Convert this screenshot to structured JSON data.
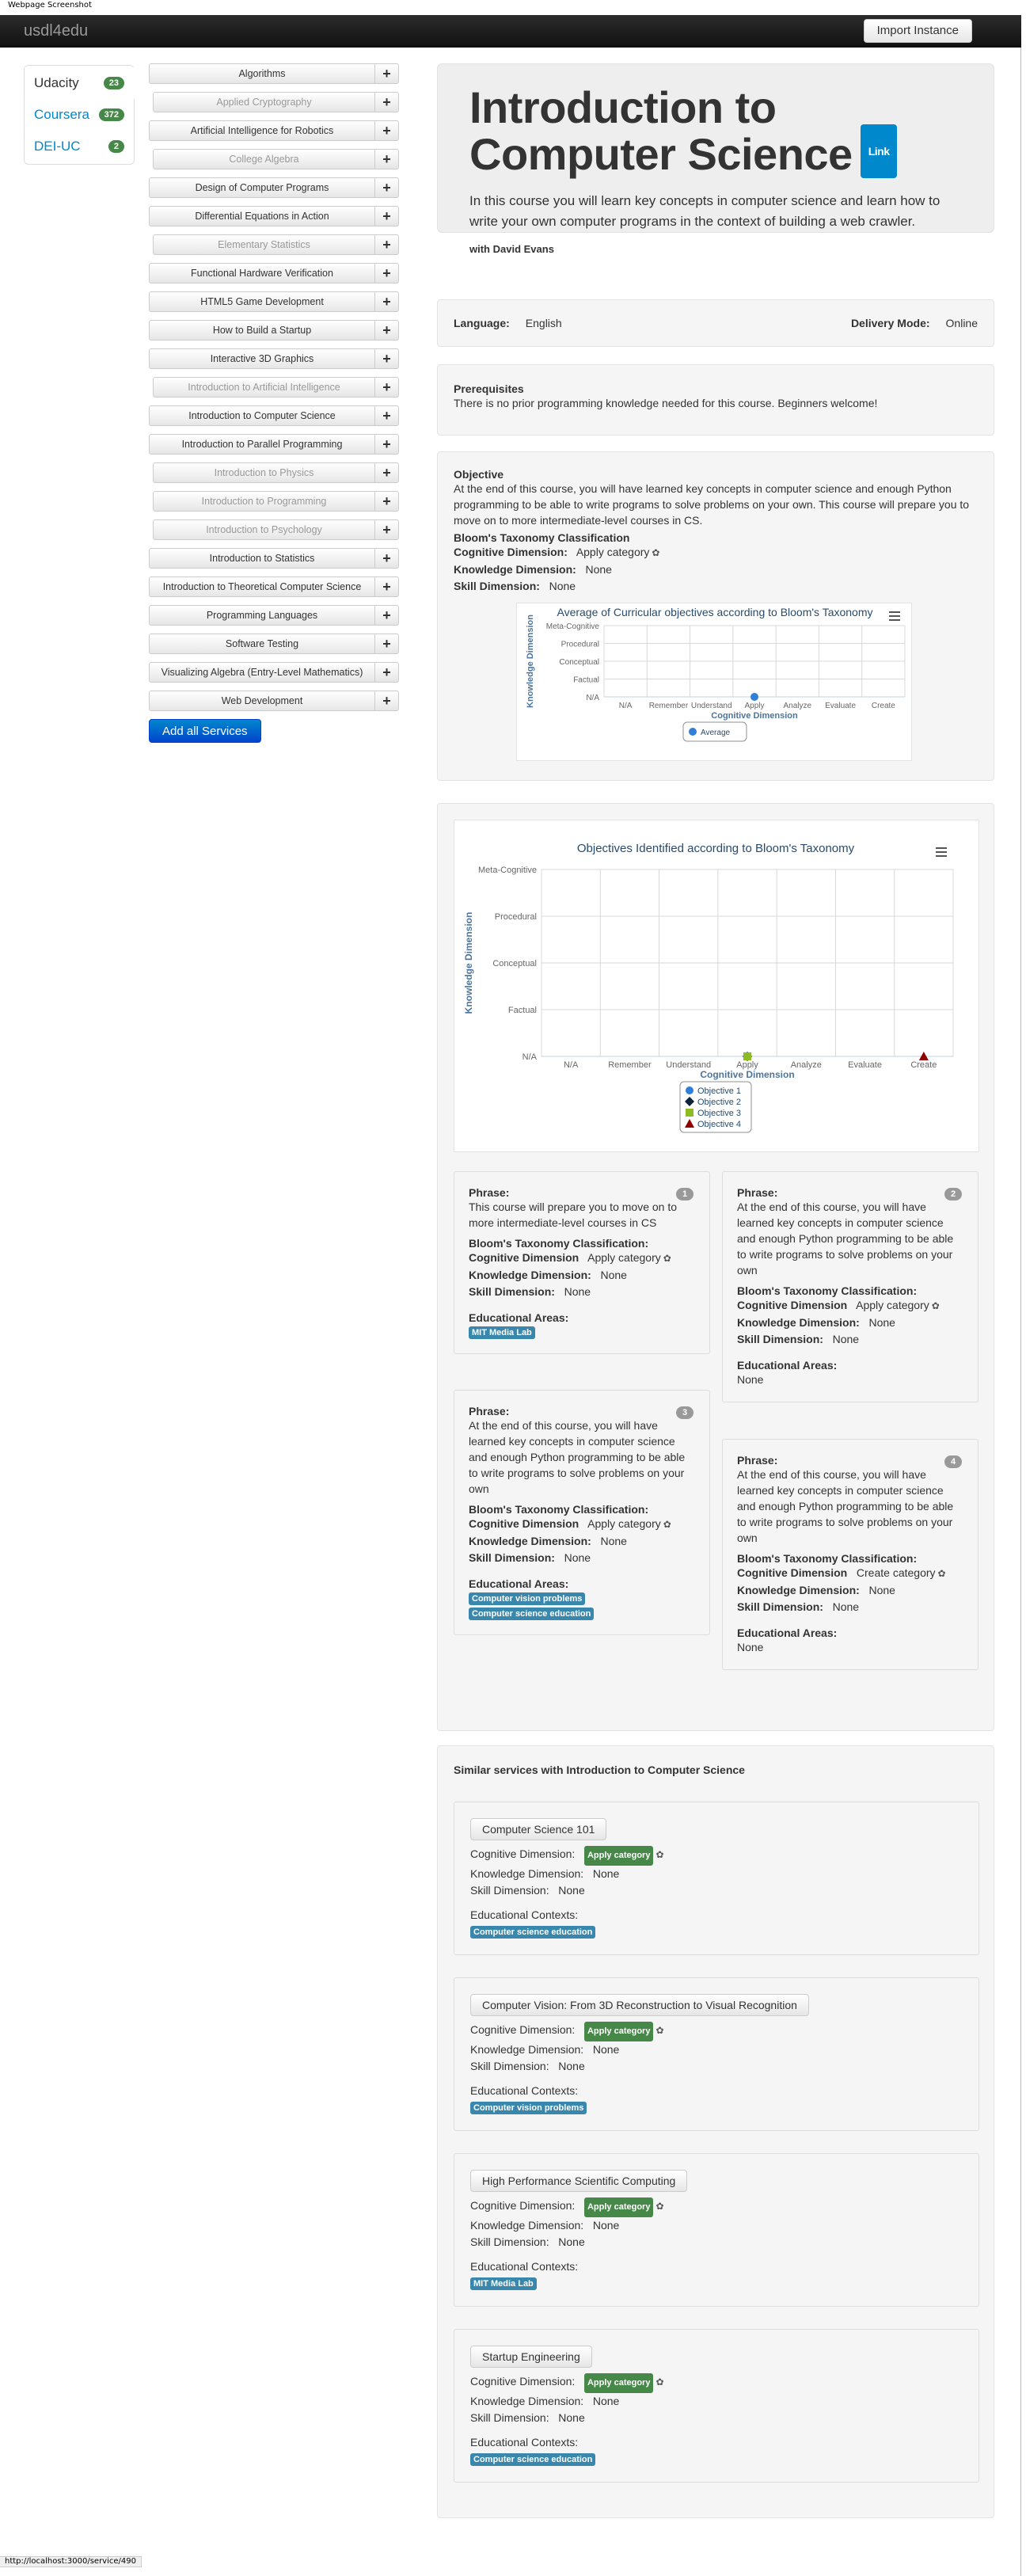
{
  "window_title": "Webpage Screenshot",
  "navbar": {
    "brand": "usdl4edu",
    "import_label": "Import Instance"
  },
  "providers": [
    {
      "name": "Udacity",
      "count": "23",
      "active": true
    },
    {
      "name": "Coursera",
      "count": "372",
      "active": false
    },
    {
      "name": "DEI-UC",
      "count": "2",
      "active": false
    }
  ],
  "services": [
    {
      "name": "Algorithms",
      "muted": false
    },
    {
      "name": "Applied Cryptography",
      "muted": true
    },
    {
      "name": "Artificial Intelligence for Robotics",
      "muted": false
    },
    {
      "name": "College Algebra",
      "muted": true
    },
    {
      "name": "Design of Computer Programs",
      "muted": false
    },
    {
      "name": "Differential Equations in Action",
      "muted": false
    },
    {
      "name": "Elementary Statistics",
      "muted": true
    },
    {
      "name": "Functional Hardware Verification",
      "muted": false
    },
    {
      "name": "HTML5 Game Development",
      "muted": false
    },
    {
      "name": "How to Build a Startup",
      "muted": false
    },
    {
      "name": "Interactive 3D Graphics",
      "muted": false
    },
    {
      "name": "Introduction to Artificial Intelligence",
      "muted": true
    },
    {
      "name": "Introduction to Computer Science",
      "muted": false
    },
    {
      "name": "Introduction to Parallel Programming",
      "muted": false
    },
    {
      "name": "Introduction to Physics",
      "muted": true
    },
    {
      "name": "Introduction to Programming",
      "muted": true
    },
    {
      "name": "Introduction to Psychology",
      "muted": true
    },
    {
      "name": "Introduction to Statistics",
      "muted": false
    },
    {
      "name": "Introduction to Theoretical Computer Science",
      "muted": false
    },
    {
      "name": "Programming Languages",
      "muted": false
    },
    {
      "name": "Software Testing",
      "muted": false
    },
    {
      "name": "Visualizing Algebra (Entry-Level Mathematics)",
      "muted": false
    },
    {
      "name": "Web Development",
      "muted": false
    }
  ],
  "add_all_label": "Add all Services",
  "course": {
    "title": "Introduction to Computer Science",
    "link_label": "Link",
    "description": "In this course you will learn key concepts in computer science and learn how to write your own computer programs in the context of building a web crawler.",
    "instructor": "with David Evans",
    "language_label": "Language:",
    "language": "English",
    "delivery_label": "Delivery Mode:",
    "delivery": "Online",
    "prereq_title": "Prerequisites",
    "prereq_text": "There is no prior programming knowledge needed for this course. Beginners welcome!",
    "objective_title": "Objective",
    "objective_text": "At the end of this course, you will have learned key concepts in computer science and enough Python programming to be able to write programs to solve problems on your own. This course will prepare you to move on to more intermediate-level courses in CS.",
    "taxonomy_title": "Bloom's Taxonomy Classification",
    "cog_label": "Cognitive Dimension:",
    "cog_value": "Apply category",
    "know_label": "Knowledge Dimension:",
    "know_value": "None",
    "skill_label": "Skill Dimension:",
    "skill_value": "None"
  },
  "chart_data": [
    {
      "type": "scatter",
      "title": "Average of Curricular objectives according to Bloom's Taxonomy",
      "xlabel": "Cognitive Dimension",
      "ylabel": "Knowledge Dimension",
      "x_categories": [
        "N/A",
        "Remember",
        "Understand",
        "Apply",
        "Analyze",
        "Evaluate",
        "Create"
      ],
      "y_categories": [
        "N/A",
        "Factual",
        "Conceptual",
        "Procedural",
        "Meta-Cognitive"
      ],
      "series": [
        {
          "name": "Average",
          "color": "#2f7ed8",
          "marker": "circle",
          "points": [
            {
              "x": "Apply",
              "y": "N/A"
            }
          ]
        }
      ],
      "legend": "bottom-center"
    },
    {
      "type": "scatter",
      "title": "Objectives Identified according to Bloom's Taxonomy",
      "xlabel": "Cognitive Dimension",
      "ylabel": "Knowledge Dimension",
      "x_categories": [
        "N/A",
        "Remember",
        "Understand",
        "Apply",
        "Analyze",
        "Evaluate",
        "Create"
      ],
      "y_categories": [
        "N/A",
        "Factual",
        "Conceptual",
        "Procedural",
        "Meta-Cognitive"
      ],
      "series": [
        {
          "name": "Objective 1",
          "color": "#2f7ed8",
          "marker": "circle",
          "points": [
            {
              "x": "Apply",
              "y": "N/A"
            }
          ]
        },
        {
          "name": "Objective 2",
          "color": "#0d233a",
          "marker": "diamond",
          "points": [
            {
              "x": "Apply",
              "y": "N/A"
            }
          ]
        },
        {
          "name": "Objective 3",
          "color": "#8bbc21",
          "marker": "square",
          "points": [
            {
              "x": "Apply",
              "y": "N/A"
            }
          ]
        },
        {
          "name": "Objective 4",
          "color": "#910000",
          "marker": "triangle",
          "points": [
            {
              "x": "Create",
              "y": "N/A"
            }
          ]
        }
      ],
      "legend": "bottom-center"
    }
  ],
  "phrases": [
    {
      "num": "1",
      "label": "Phrase:",
      "text": "This course will prepare you to move on to more intermediate-level courses in CS",
      "tax_label": "Bloom's Taxonomy Classification:",
      "cog": "Apply category",
      "know": "None",
      "skill": "None",
      "areas_label": "Educational Areas:",
      "areas": [
        "MIT Media Lab"
      ]
    },
    {
      "num": "2",
      "label": "Phrase:",
      "text": "At the end of this course, you will have learned key concepts in computer science and enough Python programming to be able to write programs to solve problems on your own",
      "tax_label": "Bloom's Taxonomy Classification:",
      "cog": "Apply category",
      "know": "None",
      "skill": "None",
      "areas_label": "Educational Areas:",
      "areas_text": "None"
    },
    {
      "num": "3",
      "label": "Phrase:",
      "text": "At the end of this course, you will have learned key concepts in computer science and enough Python programming to be able to write programs to solve problems on your own",
      "tax_label": "Bloom's Taxonomy Classification:",
      "cog": "Apply category",
      "know": "None",
      "skill": "None",
      "areas_label": "Educational Areas:",
      "areas": [
        "Computer vision problems",
        "Computer science education"
      ]
    },
    {
      "num": "4",
      "label": "Phrase:",
      "text": "At the end of this course, you will have learned key concepts in computer science and enough Python programming to be able to write programs to solve problems on your own",
      "tax_label": "Bloom's Taxonomy Classification:",
      "cog": "Create category",
      "know": "None",
      "skill": "None",
      "areas_label": "Educational Areas:",
      "areas_text": "None"
    }
  ],
  "dim_labels": {
    "cog": "Cognitive Dimension",
    "know": "Knowledge Dimension:",
    "skill": "Skill Dimension:"
  },
  "similar": {
    "title": "Similar services with Introduction to Computer Science",
    "cog_label": "Cognitive Dimension:",
    "know_label": "Knowledge Dimension:",
    "skill_label": "Skill Dimension:",
    "contexts_label": "Educational Contexts:",
    "items": [
      {
        "name": "Computer Science 101",
        "cog": "Apply category",
        "know": "None",
        "skill": "None",
        "context": "Computer science education"
      },
      {
        "name": "Computer Vision: From 3D Reconstruction to Visual Recognition",
        "cog": "Apply category",
        "know": "None",
        "skill": "None",
        "context": "Computer vision problems"
      },
      {
        "name": "High Performance Scientific Computing",
        "cog": "Apply category",
        "know": "None",
        "skill": "None",
        "context": "MIT Media Lab"
      },
      {
        "name": "Startup Engineering",
        "cog": "Apply category",
        "know": "None",
        "skill": "None",
        "context": "Computer science education"
      }
    ]
  },
  "status_url": "http://localhost:3000/service/490"
}
